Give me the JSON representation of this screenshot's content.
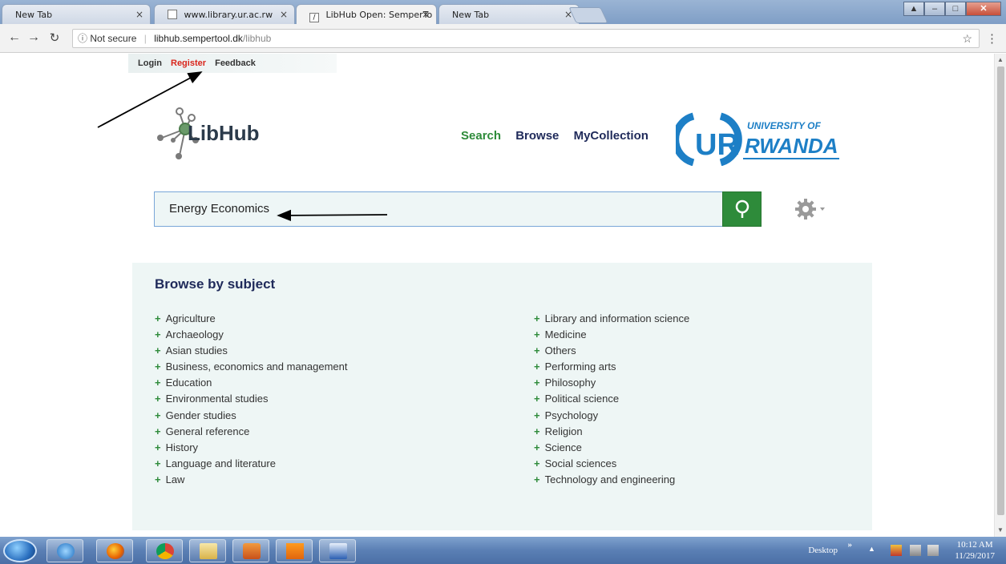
{
  "browser": {
    "tabs": [
      {
        "title": "New Tab",
        "active": false
      },
      {
        "title": "www.library.ur.ac.rw",
        "active": false
      },
      {
        "title": "LibHub Open: SemperTo",
        "active": true
      },
      {
        "title": "New Tab",
        "active": false
      }
    ],
    "close_glyph": "×",
    "url": {
      "security_label": "Not secure",
      "host": "libhub.sempertool.dk",
      "path": "/libhub"
    }
  },
  "toplinks": {
    "login": "Login",
    "register": "Register",
    "feedback": "Feedback"
  },
  "logo": {
    "text": "LibHub"
  },
  "nav": {
    "search": "Search",
    "browse": "Browse",
    "mycollection": "MyCollection"
  },
  "university": {
    "line1": "UNIVERSITY OF",
    "line2": "RWANDA"
  },
  "search": {
    "value": "Energy Economics"
  },
  "browse": {
    "heading": "Browse by subject",
    "left": [
      "Agriculture",
      "Archaeology",
      "Asian studies",
      "Business, economics and management",
      "Education",
      "Environmental studies",
      "Gender studies",
      "General reference",
      "History",
      "Language and literature",
      "Law"
    ],
    "right": [
      "Library and information science",
      "Medicine",
      "Others",
      "Performing arts",
      "Philosophy",
      "Political science",
      "Psychology",
      "Religion",
      "Science",
      "Social sciences",
      "Technology and engineering"
    ]
  },
  "taskbar": {
    "desktop_label": "Desktop",
    "time": "10:12 AM",
    "date": "11/29/2017"
  },
  "colors": {
    "green": "#2e8b3a",
    "navy": "#1f2a5a",
    "register_red": "#d9261c",
    "ur_blue": "#1d7fc6",
    "panel_bg": "#eef6f5"
  }
}
